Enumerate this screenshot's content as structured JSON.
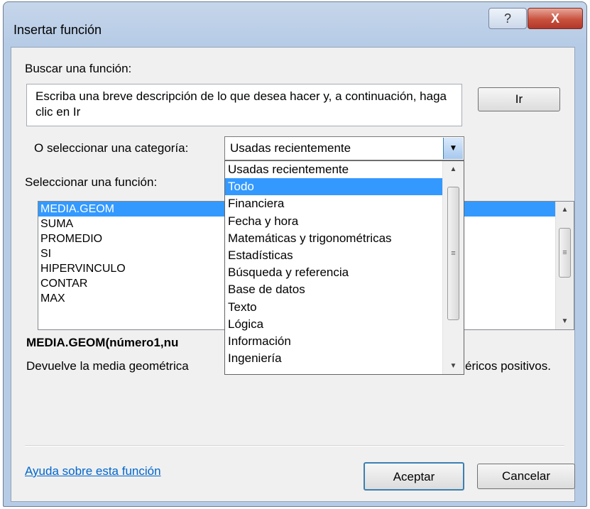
{
  "dialog": {
    "title": "Insertar función",
    "help_symbol": "?",
    "close_symbol": "X"
  },
  "search": {
    "label": "Buscar una función:",
    "text": "Escriba una breve descripción de lo que desea hacer y, a continuación, haga clic en Ir",
    "go_label": "Ir"
  },
  "category": {
    "label": "O seleccionar una categoría:",
    "selected": "Usadas recientemente",
    "options": [
      "Usadas recientemente",
      "Todo",
      "Financiera",
      "Fecha y hora",
      "Matemáticas y trigonométricas",
      "Estadísticas",
      "Búsqueda y referencia",
      "Base de datos",
      "Texto",
      "Lógica",
      "Información",
      "Ingeniería"
    ],
    "highlighted": "Todo"
  },
  "functions": {
    "label": "Seleccionar una función:",
    "items": [
      "MEDIA.GEOM",
      "SUMA",
      "PROMEDIO",
      "SI",
      "HIPERVINCULO",
      "CONTAR",
      "MAX"
    ],
    "selected": "MEDIA.GEOM",
    "signature_visible": "MEDIA.GEOM(número1,nu",
    "description_left": "Devuelve la media geométrica",
    "description_right": "éricos positivos."
  },
  "footer": {
    "help_link": "Ayuda sobre esta función",
    "ok_label": "Aceptar",
    "cancel_label": "Cancelar"
  },
  "colors": {
    "selection": "#3399ff",
    "link": "#0066cc",
    "close_button": "#c8523e"
  }
}
